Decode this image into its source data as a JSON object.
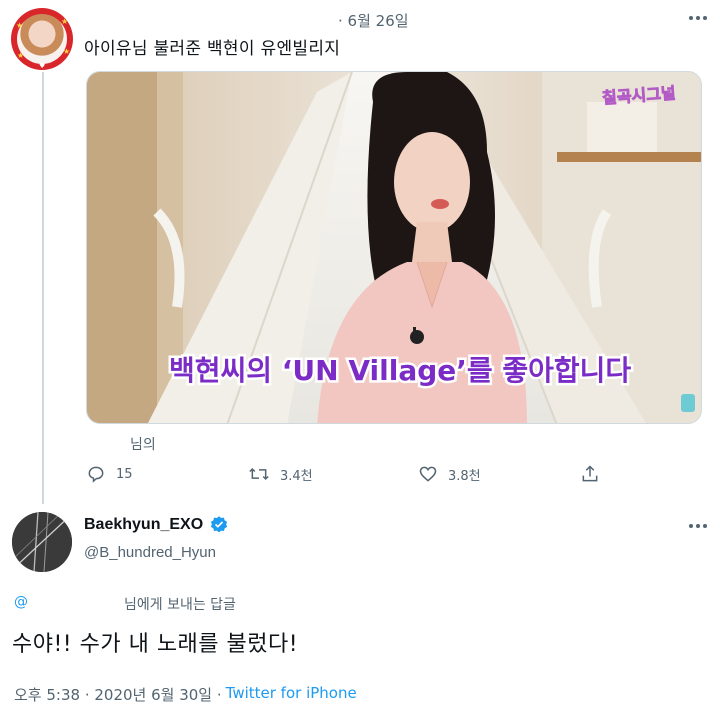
{
  "tweet1": {
    "time": "· 6월 26일",
    "text": "아이유님 불러준 백현이 유엔빌리지",
    "video": {
      "logo": "칠곡시그널",
      "subtitle": "백현씨의 ‘UN Village’를 좋아합니다"
    },
    "mention_suffix": "님의",
    "actions": {
      "reply_count": "15",
      "retweet_count": "3.4천",
      "like_count": "3.8천"
    }
  },
  "tweet2": {
    "name": "Baekhyun_EXO",
    "handle": "@B_hundred_Hyun",
    "reply_at": "@",
    "reply_label": "님에게 보내는 답글",
    "text": "수야!! 수가 내 노래를 불렀다!",
    "timestamp": "오후 5:38 · 2020년 6월 30일 ·",
    "source": "Twitter for iPhone"
  },
  "colors": {
    "accent": "#1d9bf0",
    "secondary_text": "#536471",
    "video_subtitle": "#7b2cc7"
  },
  "icons": [
    "reply-icon",
    "retweet-icon",
    "like-icon",
    "share-icon",
    "verified-badge-icon",
    "more-icon"
  ]
}
